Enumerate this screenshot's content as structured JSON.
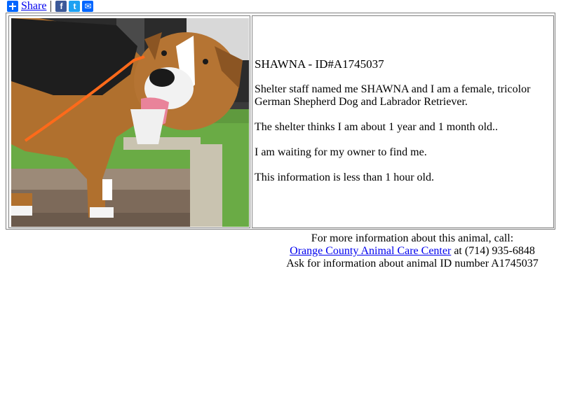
{
  "share_bar": {
    "share_label": "Share",
    "icons": [
      "plus-icon",
      "facebook-icon",
      "twitter-icon",
      "email-icon"
    ],
    "facebook_glyph": "f",
    "twitter_glyph": "t",
    "email_glyph": "✉"
  },
  "pet": {
    "title": "SHAWNA - ID#A1745037",
    "description": "Shelter staff named me SHAWNA and I am a female, tricolor German Shepherd Dog and Labrador Retriever.",
    "age": "The shelter thinks I am about 1 year and 1 month old..",
    "waiting": "I am waiting for my owner to find me.",
    "freshness": "This information is less than 1 hour old."
  },
  "footer": {
    "line1": "For more information about this animal, call:",
    "shelter_link": "Orange County Animal Care Center",
    "phone_text": " at (714) 935-6848",
    "line3": "Ask for information about animal ID number A1745037"
  },
  "colors": {
    "link": "#0000ee",
    "share_blue": "#0166ff",
    "facebook": "#3b5998",
    "twitter": "#1da1f2"
  }
}
